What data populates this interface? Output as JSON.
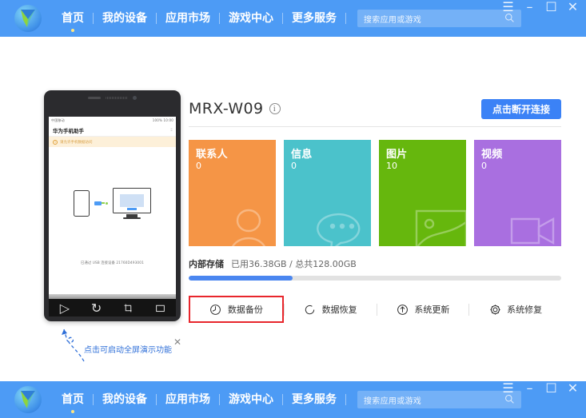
{
  "header": {
    "logo_name": "huawei-hisuite-logo",
    "nav_items": [
      {
        "label": "首页",
        "active": true
      },
      {
        "label": "我的设备",
        "active": false
      },
      {
        "label": "应用市场",
        "active": false
      },
      {
        "label": "游戏中心",
        "active": false
      },
      {
        "label": "更多服务",
        "active": false
      }
    ],
    "search": {
      "placeholder": "搜索应用或游戏",
      "value": ""
    },
    "window_controls": [
      {
        "name": "menu-button",
        "glyph": "☰"
      },
      {
        "name": "minimize-button",
        "glyph": "–"
      },
      {
        "name": "maximize-button",
        "glyph": "☐"
      },
      {
        "name": "close-button",
        "glyph": "✕"
      }
    ],
    "accent_color": "#4d9bf5"
  },
  "phone_preview": {
    "status_left": "中国移动",
    "status_right": "100% 10:00",
    "app_title": "华为手机助手",
    "title_icon": "grid-icon",
    "notice_text": "请允许手机数据访问",
    "caption": "已通过 USB 连接设备 21760D493001",
    "nav_buttons": [
      {
        "name": "play-icon",
        "glyph": "▷"
      },
      {
        "name": "refresh-icon",
        "glyph": "↻"
      },
      {
        "name": "screenshot-icon",
        "glyph": "⬚"
      },
      {
        "name": "folder-icon",
        "glyph": "▭"
      }
    ]
  },
  "annotation": {
    "text": "点击可启动全屏演示功能",
    "close_glyph": "✕",
    "color": "#2f6fd8"
  },
  "device": {
    "name": "MRX-W09",
    "info_icon_glyph": "i",
    "disconnect_label": "点击断开连接"
  },
  "tiles": [
    {
      "label": "联系人",
      "count": "0",
      "color": "#F59546",
      "art": "contacts-art"
    },
    {
      "label": "信息",
      "count": "0",
      "color": "#4BC2CB",
      "art": "messages-art"
    },
    {
      "label": "图片",
      "count": "10",
      "color": "#66B70D",
      "art": "pictures-art"
    },
    {
      "label": "视频",
      "count": "0",
      "color": "#A96FE0",
      "art": "video-art"
    }
  ],
  "storage": {
    "label": "内部存储",
    "value": "已用36.38GB / 总共128.00GB",
    "used_gb": 36.38,
    "total_gb": 128.0,
    "percent": 28,
    "fill_color": "#4a86f0"
  },
  "actions": [
    {
      "label": "数据备份",
      "icon": "backup-icon",
      "highlighted": true
    },
    {
      "label": "数据恢复",
      "icon": "restore-icon",
      "highlighted": false
    },
    {
      "label": "系统更新",
      "icon": "update-icon",
      "highlighted": false
    },
    {
      "label": "系统修复",
      "icon": "repair-icon",
      "highlighted": false
    }
  ],
  "highlight_color": "#e8262c"
}
